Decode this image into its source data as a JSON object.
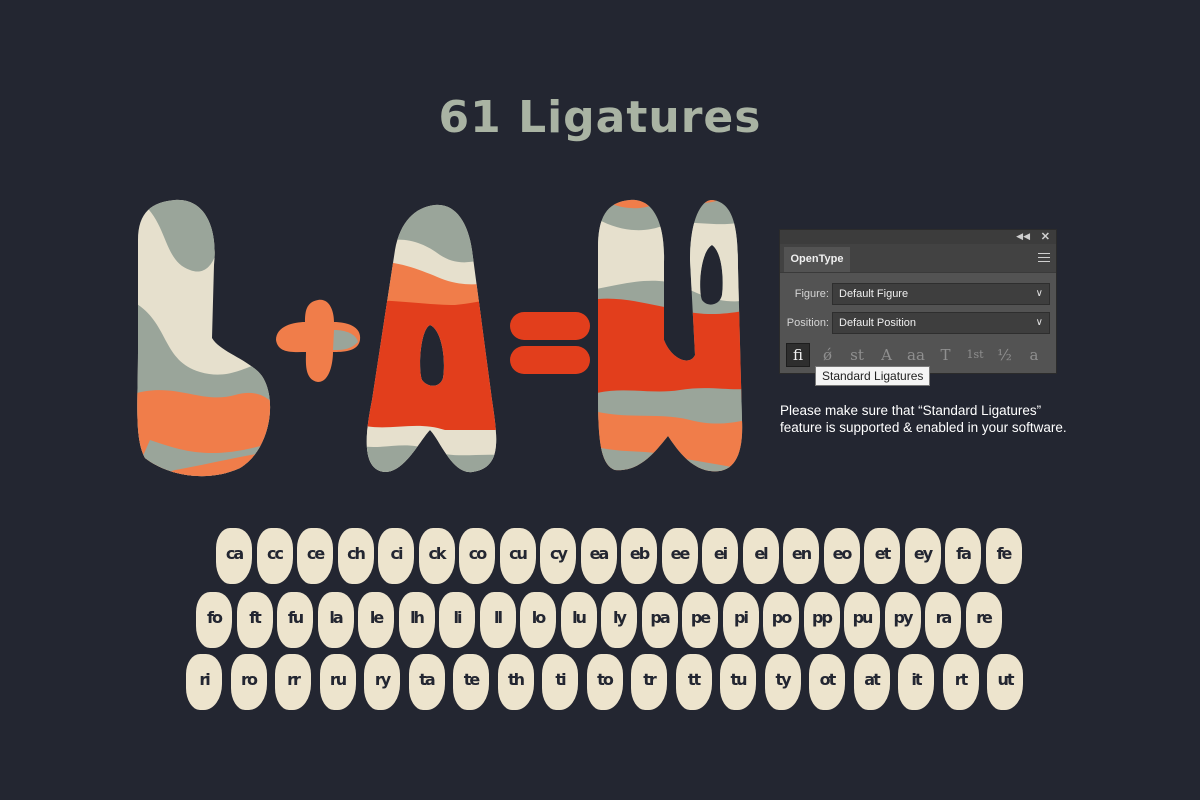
{
  "title": "61 Ligatures",
  "equation": {
    "left": "L",
    "plus": "+",
    "middle": "A",
    "equals": "=",
    "result": "LA"
  },
  "colors": {
    "background": "#232631",
    "title": "#a9b3a3",
    "sage": "#9aa59a",
    "cream": "#e6e0cd",
    "orange": "#f07d4a",
    "red": "#e23e1c",
    "glyph_fill": "#ede4cd"
  },
  "panel": {
    "tab": "OpenType",
    "figure_label": "Figure:",
    "figure_value": "Default Figure",
    "position_label": "Position:",
    "position_value": "Default Position",
    "icons": [
      {
        "glyph": "fi",
        "name": "standard-ligatures-icon"
      },
      {
        "glyph": "ǿ",
        "name": "contextual-alternates-icon"
      },
      {
        "glyph": "st",
        "name": "discretionary-ligatures-icon"
      },
      {
        "glyph": "A",
        "name": "swash-icon"
      },
      {
        "glyph": "aa",
        "name": "stylistic-alternates-icon"
      },
      {
        "glyph": "T",
        "name": "titling-alternates-icon"
      },
      {
        "glyph": "1st",
        "name": "ordinals-icon"
      },
      {
        "glyph": "½",
        "name": "fractions-icon"
      },
      {
        "glyph": "a",
        "name": "stylistic-sets-icon"
      }
    ],
    "tooltip": "Standard Ligatures"
  },
  "note": "Please make sure that “Standard Ligatures” feature is supported & enabled in your software.",
  "ligatures": [
    [
      "ca",
      "cc",
      "ce",
      "ch",
      "ci",
      "ck",
      "co",
      "cu",
      "cy",
      "ea",
      "eb",
      "ee",
      "ei",
      "el",
      "en",
      "eo",
      "et",
      "ey",
      "fa",
      "fe"
    ],
    [
      "fo",
      "ft",
      "fu",
      "la",
      "le",
      "lh",
      "li",
      "ll",
      "lo",
      "lu",
      "ly",
      "pa",
      "pe",
      "pi",
      "po",
      "pp",
      "pu",
      "py",
      "ra",
      "re"
    ],
    [
      "ri",
      "ro",
      "rr",
      "ru",
      "ry",
      "ta",
      "te",
      "th",
      "ti",
      "to",
      "tr",
      "tt",
      "tu",
      "ty",
      "ot",
      "at",
      "it",
      "rt",
      "ut"
    ]
  ]
}
